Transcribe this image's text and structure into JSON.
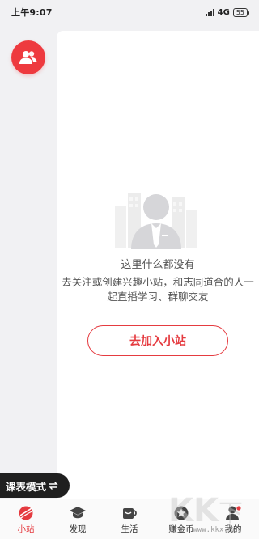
{
  "status_bar": {
    "time": "上午9:07",
    "network": "4G",
    "battery": "55"
  },
  "sidebar": {
    "avatar_icon": "group-icon"
  },
  "empty_state": {
    "title": "这里什么都没有",
    "description": "去关注或创建兴趣小站，和志同道合的人一起直播学习、群聊交友",
    "button_label": "去加入小站"
  },
  "mode_pill": {
    "label": "课表模式",
    "icon": "swap-icon"
  },
  "tabs": [
    {
      "label": "小站",
      "icon": "station-icon",
      "active": true
    },
    {
      "label": "发现",
      "icon": "graduation-cap-icon",
      "active": false
    },
    {
      "label": "生活",
      "icon": "cup-icon",
      "active": false
    },
    {
      "label": "赚金币",
      "icon": "coin-icon",
      "active": false
    },
    {
      "label": "我的",
      "icon": "profile-icon",
      "active": false
    }
  ],
  "watermark": {
    "text": "www.kkx.net"
  },
  "colors": {
    "accent": "#e53b40",
    "background": "#f1f1f3",
    "panel": "#ffffff"
  }
}
